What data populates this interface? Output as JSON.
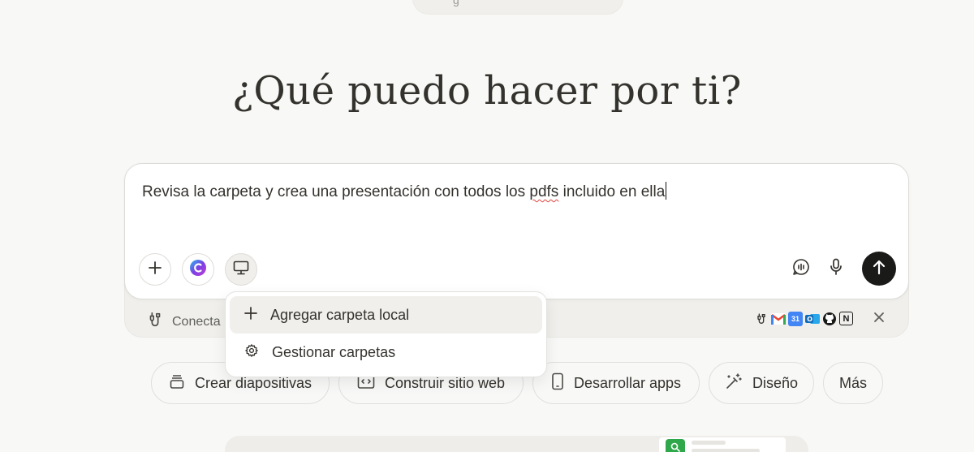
{
  "top_pill": {
    "text": "g"
  },
  "heading": "¿Qué puedo hacer por ti?",
  "composer": {
    "text_before": "Revisa la carpeta y crea una presentación con todos los ",
    "misspelled": "pdfs",
    "text_after": " incluido en ella"
  },
  "toolbar": {
    "left": [
      {
        "icon": "plus-icon"
      },
      {
        "icon": "brand-c-icon"
      },
      {
        "icon": "monitor-icon"
      }
    ],
    "right": [
      {
        "icon": "voice-chat-icon"
      },
      {
        "icon": "microphone-icon"
      },
      {
        "icon": "arrow-up-icon"
      }
    ]
  },
  "connect": {
    "label": "Conecta",
    "apps": [
      "plug-icon",
      "gmail-icon",
      "calendar-icon",
      "outlook-icon",
      "github-icon",
      "notion-icon"
    ]
  },
  "dropdown": {
    "items": [
      {
        "icon": "plus-icon",
        "label": "Agregar carpeta local"
      },
      {
        "icon": "gear-icon",
        "label": "Gestionar carpetas"
      }
    ]
  },
  "chips": [
    {
      "icon": "stack-icon",
      "label": "Crear diapositivas"
    },
    {
      "icon": "code-icon",
      "label": "Construir sitio web"
    },
    {
      "icon": "phone-icon",
      "label": "Desarrollar apps"
    },
    {
      "icon": "wand-icon",
      "label": "Diseño"
    },
    {
      "icon": "",
      "label": "Más"
    }
  ],
  "colors": {
    "background": "#f8f8f7",
    "text": "#34322d",
    "send_button": "#1a1a19",
    "spell_error": "#e0443e",
    "gmail_red": "#ea4335",
    "calendar_blue": "#4285f4",
    "outlook_blue": "#0f6cbd",
    "preview_green": "#2ea84a"
  }
}
